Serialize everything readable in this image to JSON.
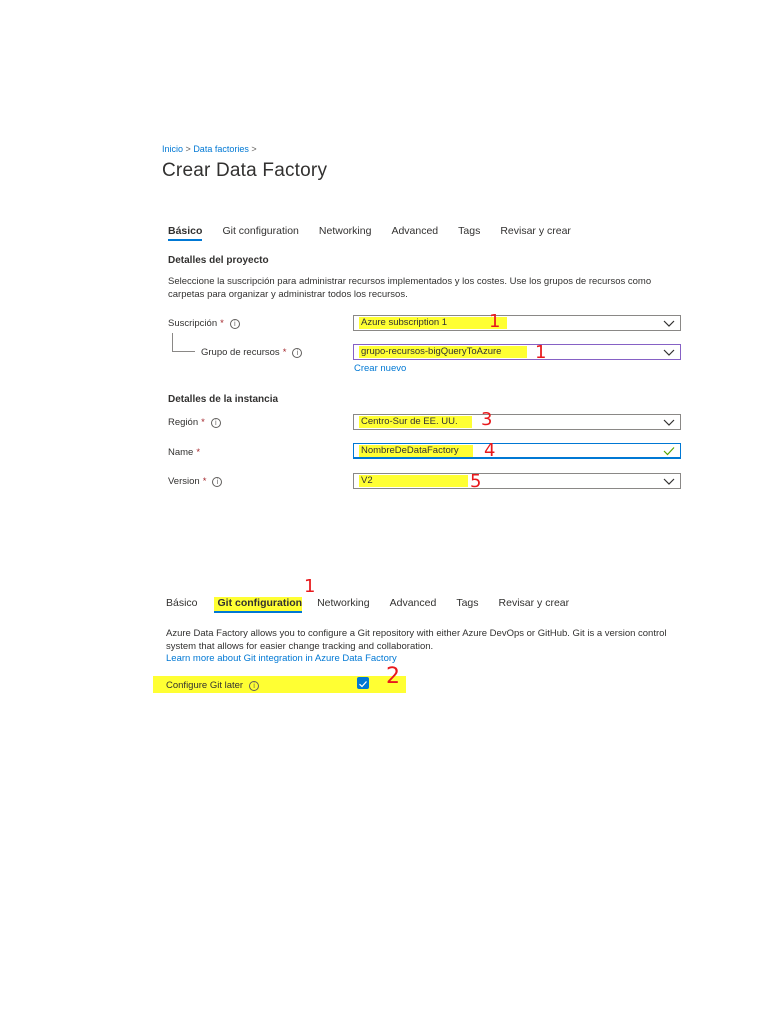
{
  "breadcrumb": {
    "home": "Inicio",
    "separator": ">",
    "parent": "Data factories"
  },
  "page": {
    "title": "Crear Data Factory"
  },
  "tabs_top": [
    "Básico",
    "Git configuration",
    "Networking",
    "Advanced",
    "Tags",
    "Revisar y crear"
  ],
  "basics": {
    "project_heading": "Detalles del proyecto",
    "project_desc": "Seleccione la suscripción para administrar recursos implementados y los costes. Use los grupos de recursos como carpetas para organizar y administrar todos los recursos.",
    "subscription_label": "Suscripción",
    "subscription_value": "Azure subscription 1",
    "rg_label": "Grupo de recursos",
    "rg_value": "grupo-recursos-bigQueryToAzure",
    "create_new": "Crear nuevo",
    "instance_heading": "Detalles de la instancia",
    "region_label": "Región",
    "region_value": "Centro-Sur de EE. UU.",
    "name_label": "Name",
    "name_value": "NombreDeDataFactory",
    "version_label": "Version",
    "version_value": "V2",
    "required_mark": "*",
    "info_glyph": "i"
  },
  "tabs_bottom": [
    "Básico",
    "Git configuration",
    "Networking",
    "Advanced",
    "Tags",
    "Revisar y crear"
  ],
  "git": {
    "desc": "Azure Data Factory allows you to configure a Git repository with either Azure DevOps or GitHub. Git is a version control system that allows for easier change tracking and collaboration.",
    "learn_more": "Learn more about Git integration in Azure Data Factory",
    "configure_later_label": "Configure Git later",
    "configure_later_checked": true
  },
  "annotations": {
    "subscription": "1",
    "resource_group": "1",
    "region": "3",
    "name": "4",
    "version": "5",
    "git_tab": "1",
    "git_later": "2"
  },
  "colors": {
    "accent": "#0078d4",
    "highlight": "#ffff33",
    "annotation": "#e8191c",
    "required": "#a4262c",
    "success": "#57a300"
  }
}
